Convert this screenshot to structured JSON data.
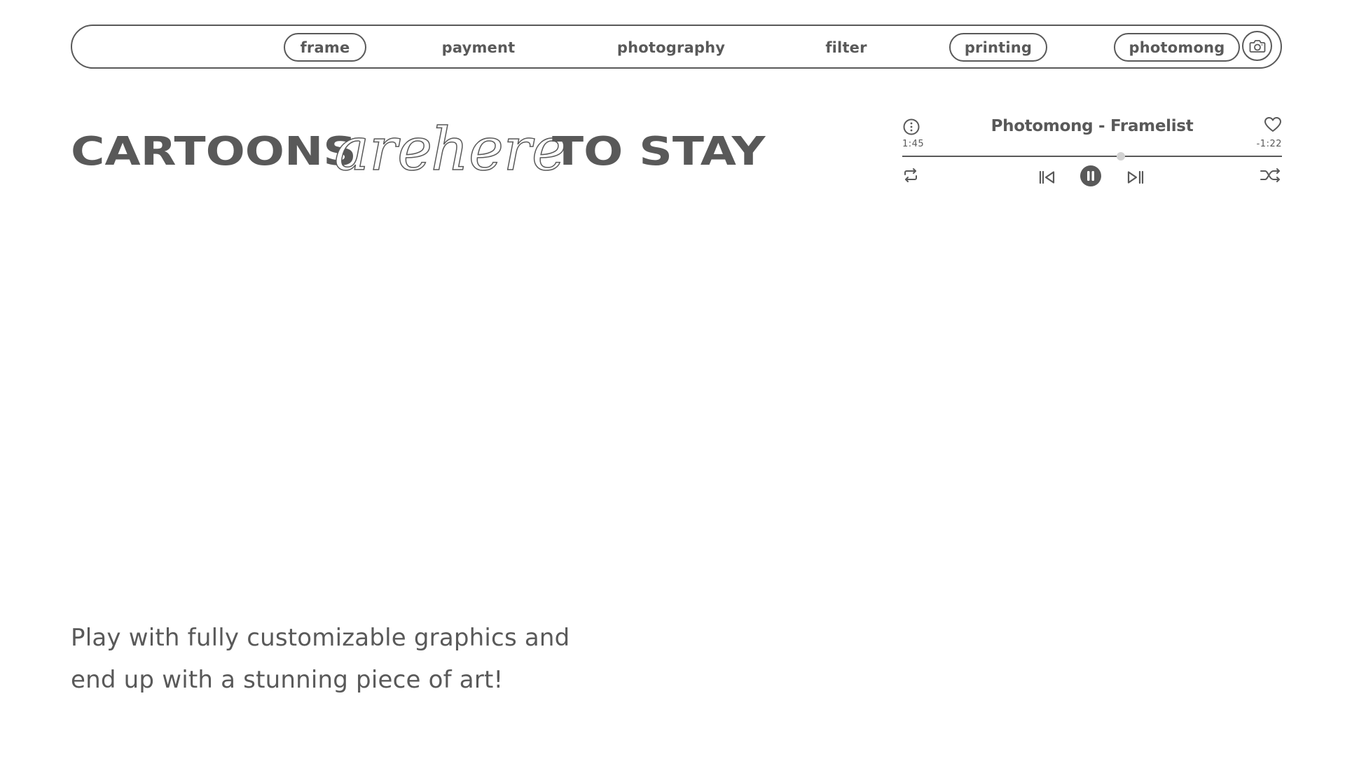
{
  "nav": {
    "items": [
      {
        "label": "frame",
        "outlined": true
      },
      {
        "label": "payment",
        "outlined": false
      },
      {
        "label": "photography",
        "outlined": false
      },
      {
        "label": "filter",
        "outlined": false
      },
      {
        "label": "printing",
        "outlined": true
      },
      {
        "label": "photomong",
        "outlined": true
      }
    ],
    "camera_icon": "camera-icon"
  },
  "headline": {
    "part1": "CARTOONS",
    "part2": "are",
    "part3": "here",
    "part4": "TO STAY"
  },
  "player": {
    "title": "Photomong - Framelist",
    "elapsed": "1:45",
    "remaining": "-1:22",
    "progress": 0.575,
    "state": "playing",
    "icons": [
      "info-icon",
      "heart-icon",
      "repeat-icon",
      "skip-back-icon",
      "pause-icon",
      "play-next-icon",
      "shuffle-icon"
    ]
  },
  "tagline": {
    "line1": "Play with fully customizable graphics and",
    "line2": "end up with a stunning piece of art!"
  },
  "colors": {
    "primary": "#595959",
    "knob": "#d2d2d2",
    "background": "#ffffff"
  }
}
